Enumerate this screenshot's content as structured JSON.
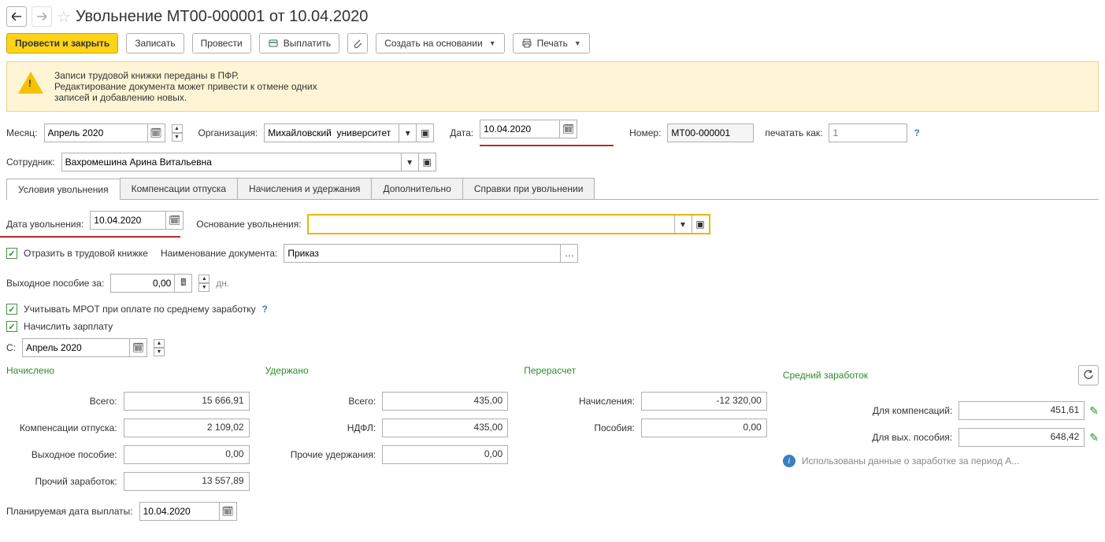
{
  "title": "Увольнение МТ00-000001 от 10.04.2020",
  "toolbar": {
    "post_close": "Провести и закрыть",
    "save": "Записать",
    "post": "Провести",
    "pay": "Выплатить",
    "create_based": "Создать на основании",
    "print": "Печать"
  },
  "warning": {
    "line1": "Записи трудовой книжки переданы в ПФР.",
    "line2": "Редактирование документа может привести к отмене одних",
    "line3": "записей и добавлению новых."
  },
  "head": {
    "month_lbl": "Месяц:",
    "month_val": "Апрель 2020",
    "org_lbl": "Организация:",
    "org_val": "Михайловский  университет",
    "date_lbl": "Дата:",
    "date_val": "10.04.2020",
    "num_lbl": "Номер:",
    "num_val": "МТ00-000001",
    "printas_lbl": "печатать как:",
    "printas_ph": "1",
    "emp_lbl": "Сотрудник:",
    "emp_val": "Вахромешина Арина Витальевна"
  },
  "tabs": [
    "Условия увольнения",
    "Компенсации отпуска",
    "Начисления и удержания",
    "Дополнительно",
    "Справки при увольнении"
  ],
  "cond": {
    "dis_date_lbl": "Дата увольнения:",
    "dis_date_val": "10.04.2020",
    "basis_lbl": "Основание увольнения:",
    "basis_val": "",
    "reflect_lbl": "Отразить в трудовой книжке",
    "docname_lbl": "Наименование документа:",
    "docname_val": "Приказ",
    "sev_lbl": "Выходное пособие за:",
    "sev_val": "0,00",
    "sev_unit": "дн.",
    "mrot_lbl": "Учитывать МРОТ при оплате по среднему заработку",
    "payroll_lbl": "Начислить зарплату",
    "from_lbl": "С:",
    "from_val": "Апрель 2020"
  },
  "sections": {
    "accrued": "Начислено",
    "withheld": "Удержано",
    "recalc": "Перерасчет",
    "avg": "Средний заработок"
  },
  "accrued": {
    "total_lbl": "Всего:",
    "total": "15 666,91",
    "vac_lbl": "Компенсации отпуска:",
    "vac": "2 109,02",
    "sev_lbl": "Выходное пособие:",
    "sev": "0,00",
    "other_lbl": "Прочий заработок:",
    "other": "13 557,89"
  },
  "withheld": {
    "total_lbl": "Всего:",
    "total": "435,00",
    "ndfl_lbl": "НДФЛ:",
    "ndfl": "435,00",
    "other_lbl": "Прочие удержания:",
    "other": "0,00"
  },
  "recalc": {
    "accr_lbl": "Начисления:",
    "accr": "-12 320,00",
    "ben_lbl": "Пособия:",
    "ben": "0,00"
  },
  "avg": {
    "comp_lbl": "Для компенсаций:",
    "comp": "451,61",
    "sev_lbl": "Для вых. пособия:",
    "sev": "648,42",
    "info": "Использованы данные о заработке за период А..."
  },
  "plan_date_lbl": "Планируемая дата выплаты:",
  "plan_date_val": "10.04.2020"
}
